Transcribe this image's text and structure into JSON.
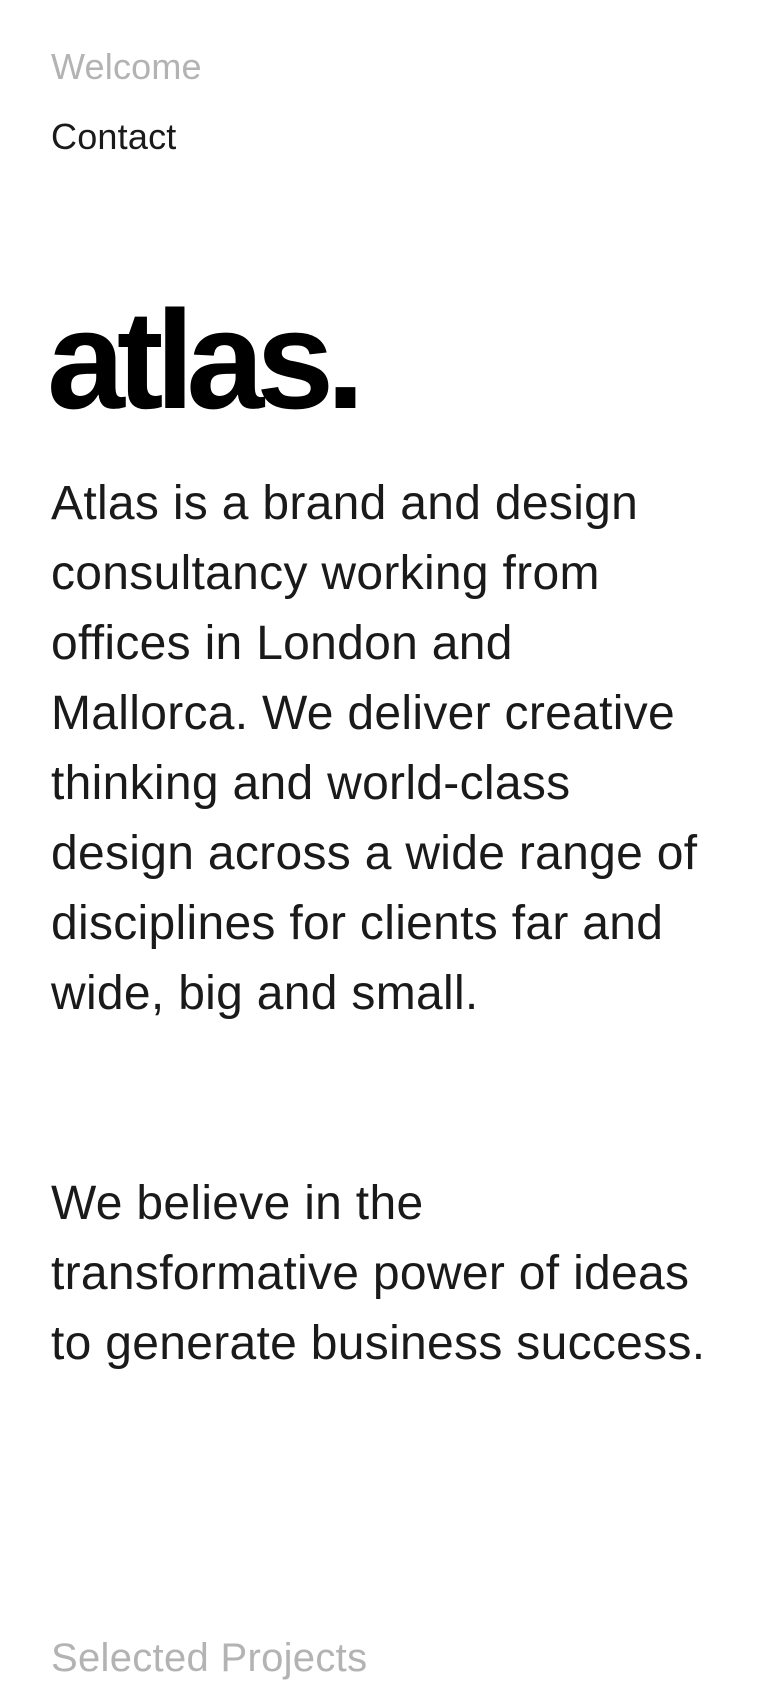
{
  "nav": {
    "welcome_label": "Welcome",
    "contact_label": "Contact"
  },
  "brand": {
    "logo_text": "atlas."
  },
  "main": {
    "intro_text": "Atlas is a brand and design consultancy working from offices in London and Mallorca. We deliver creative thinking and world-class design across a wide range of disciplines for clients far and wide, big and small.",
    "belief_text": "We believe in the transformative power of ideas to generate business success.",
    "projects_heading": "Selected Projects"
  },
  "colors": {
    "text": "#1a1a1a",
    "muted": "#b3b3b3",
    "logo": "#000000",
    "background": "#ffffff"
  }
}
